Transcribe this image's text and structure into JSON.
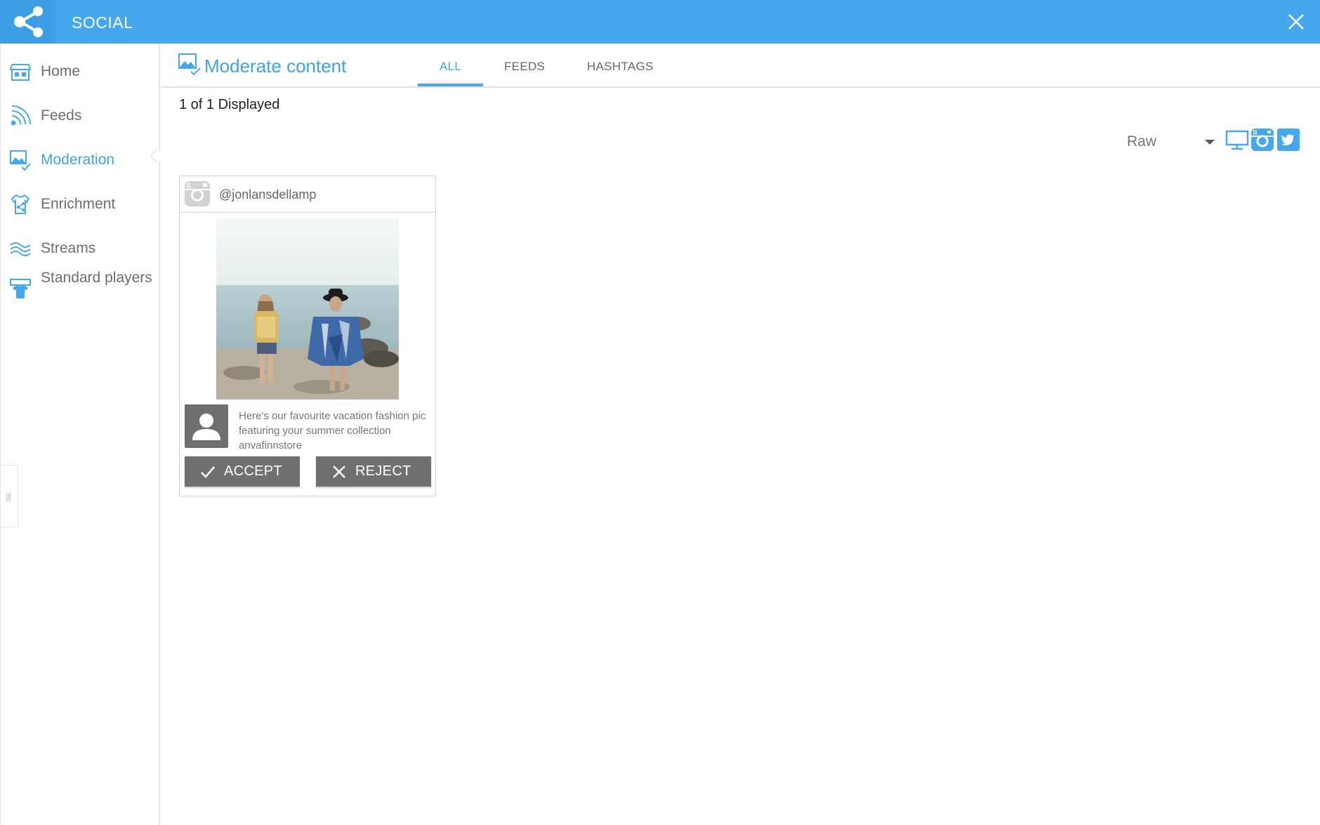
{
  "app": {
    "title": "SOCIAL"
  },
  "sidebar": {
    "items": [
      {
        "label": "Home",
        "icon": "home-store-icon"
      },
      {
        "label": "Feeds",
        "icon": "rss-feed-icon"
      },
      {
        "label": "Moderation",
        "icon": "image-check-icon",
        "active": true
      },
      {
        "label": "Enrichment",
        "icon": "shirt-share-icon"
      },
      {
        "label": "Streams",
        "icon": "waves-icon"
      },
      {
        "label": "Standard players",
        "icon": "shirt-display-icon"
      }
    ]
  },
  "header": {
    "title": "Moderate content",
    "tabs": [
      {
        "label": "ALL",
        "active": true
      },
      {
        "label": "FEEDS"
      },
      {
        "label": "HASHTAGS"
      }
    ]
  },
  "status": {
    "count_text": "1 of 1 Displayed"
  },
  "filters": {
    "view_select": {
      "value": "Raw"
    },
    "source_icons": [
      "monitor-icon",
      "instagram-icon",
      "twitter-icon"
    ]
  },
  "post": {
    "source": "instagram",
    "username": "@jonlansdellamp",
    "caption": "Here's our favourite vacation fashion pic featuring your summer collection anvafinnstore",
    "accept_label": "ACCEPT",
    "reject_label": "REJECT"
  },
  "colors": {
    "brand": "#46a8ec",
    "accent_text": "#3fa2e6",
    "button_gray": "#707070"
  }
}
